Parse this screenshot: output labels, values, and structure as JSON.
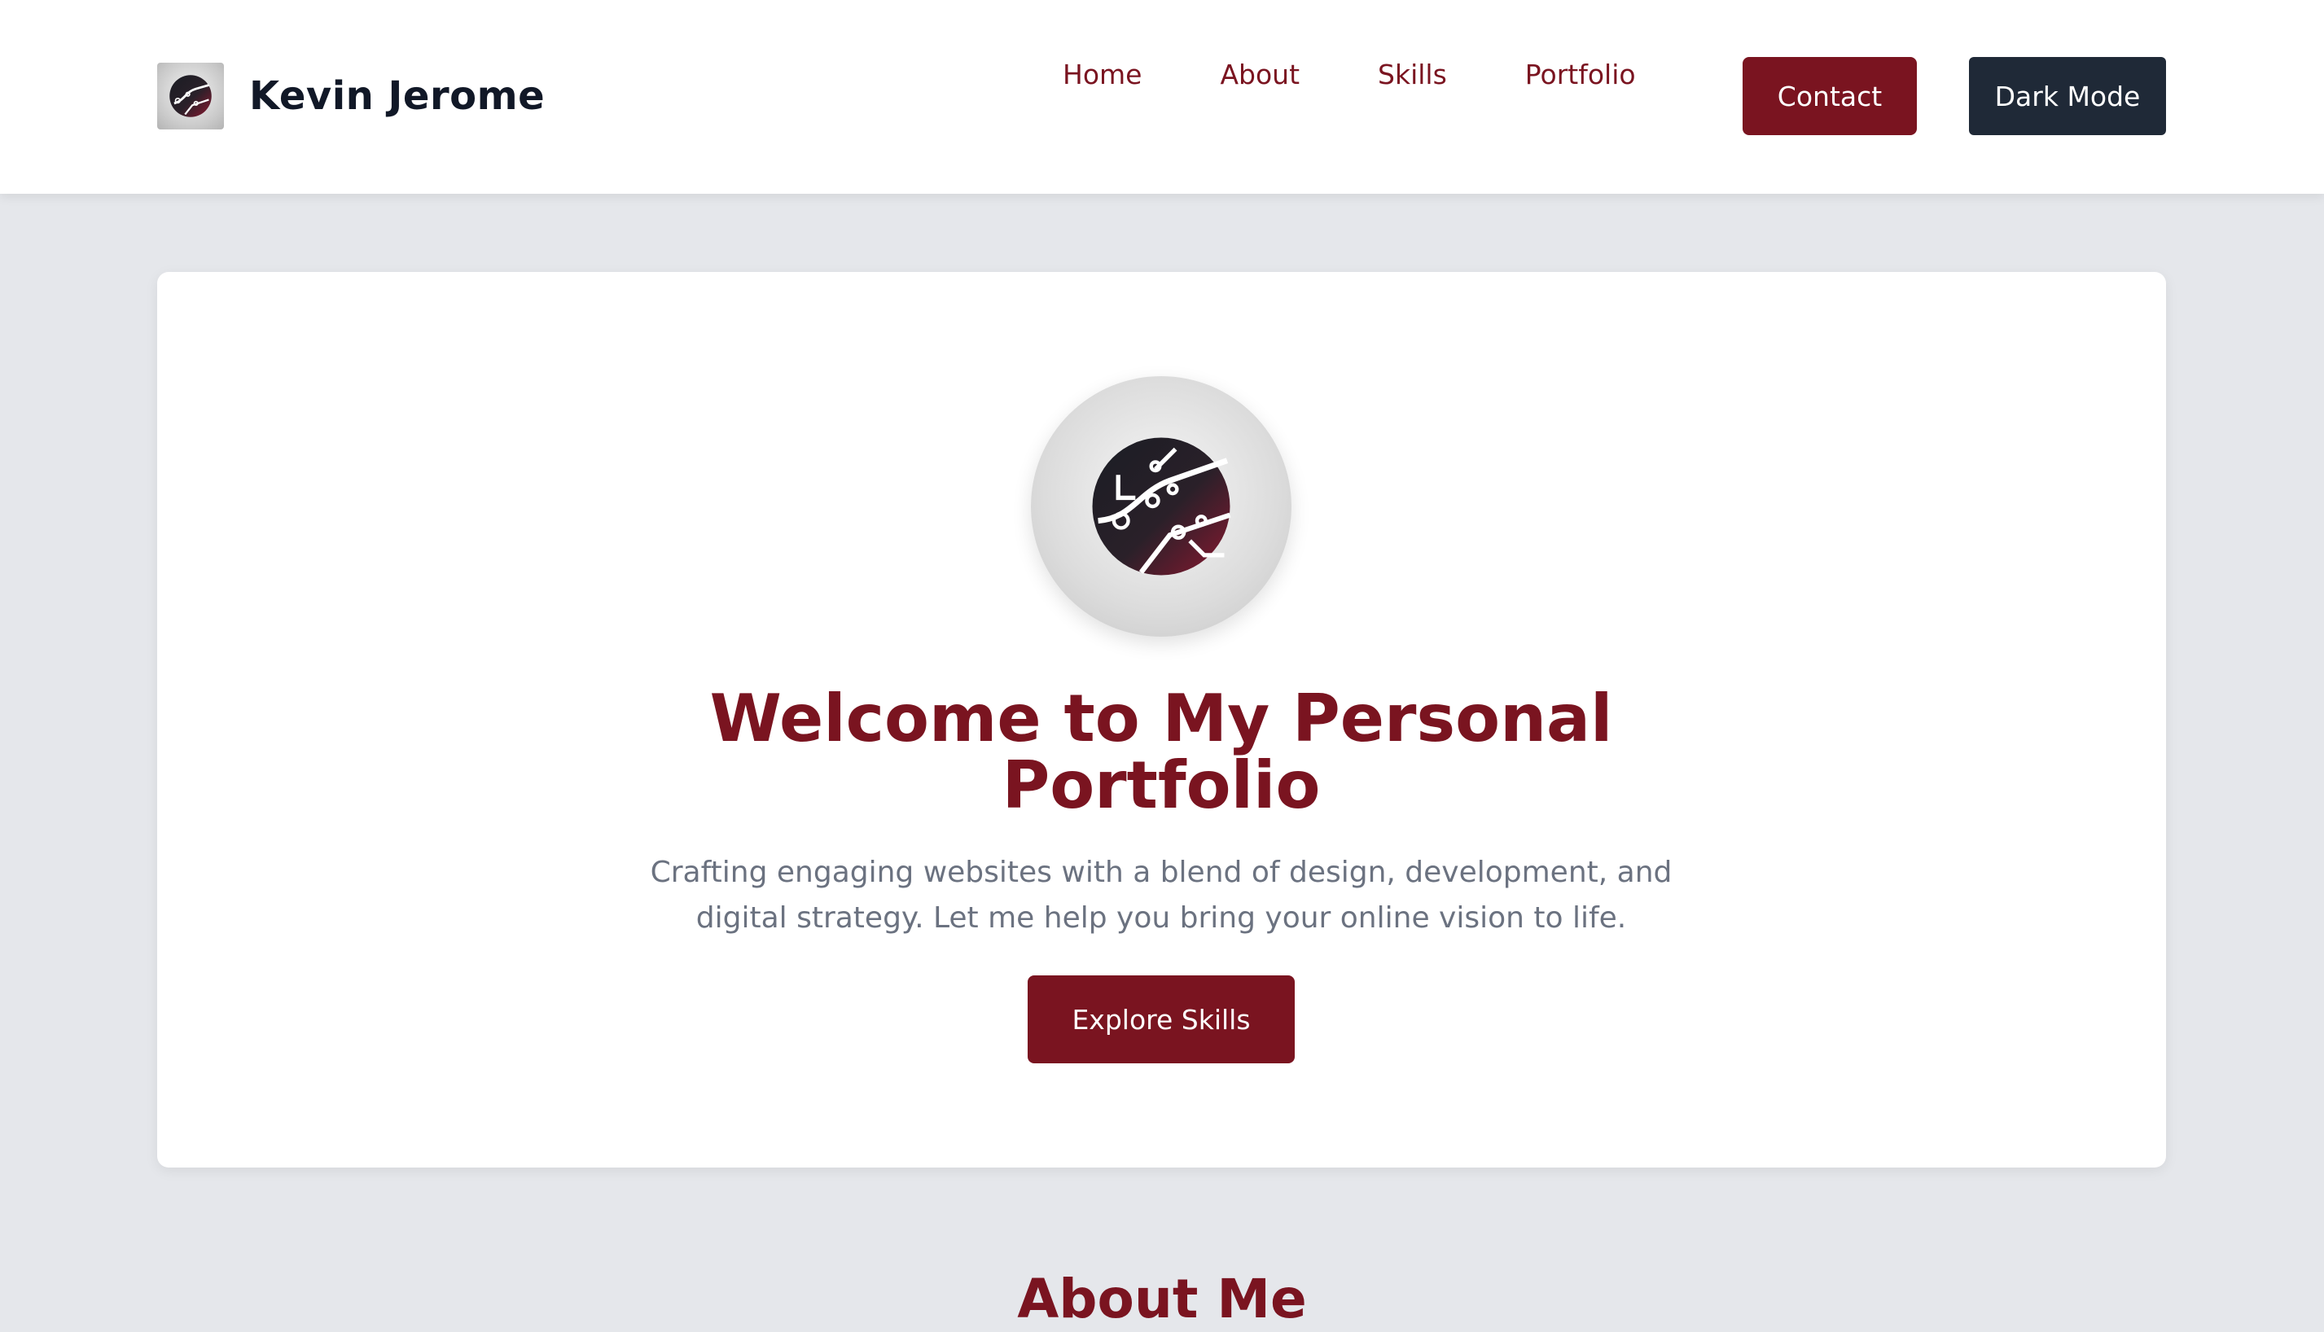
{
  "navbar": {
    "brand_name": "Kevin Jerome",
    "brand_logo_icon": "circuit-globe-icon",
    "links": [
      {
        "label": "Home"
      },
      {
        "label": "About"
      },
      {
        "label": "Skills"
      },
      {
        "label": "Portfolio"
      }
    ],
    "contact_label": "Contact",
    "dark_mode_label": "Dark Mode"
  },
  "hero": {
    "avatar_icon": "circuit-globe-icon",
    "title": "Welcome to My Personal Portfolio",
    "subtitle": "Crafting engaging websites with a blend of design, development, and digital strategy. Let me help you bring your online vision to life.",
    "cta_label": "Explore Skills"
  },
  "about": {
    "title": "About Me"
  },
  "colors": {
    "accent": "#7a1420",
    "dark": "#1f2937",
    "page_bg": "#e5e7eb",
    "text_muted": "#6b7280"
  }
}
